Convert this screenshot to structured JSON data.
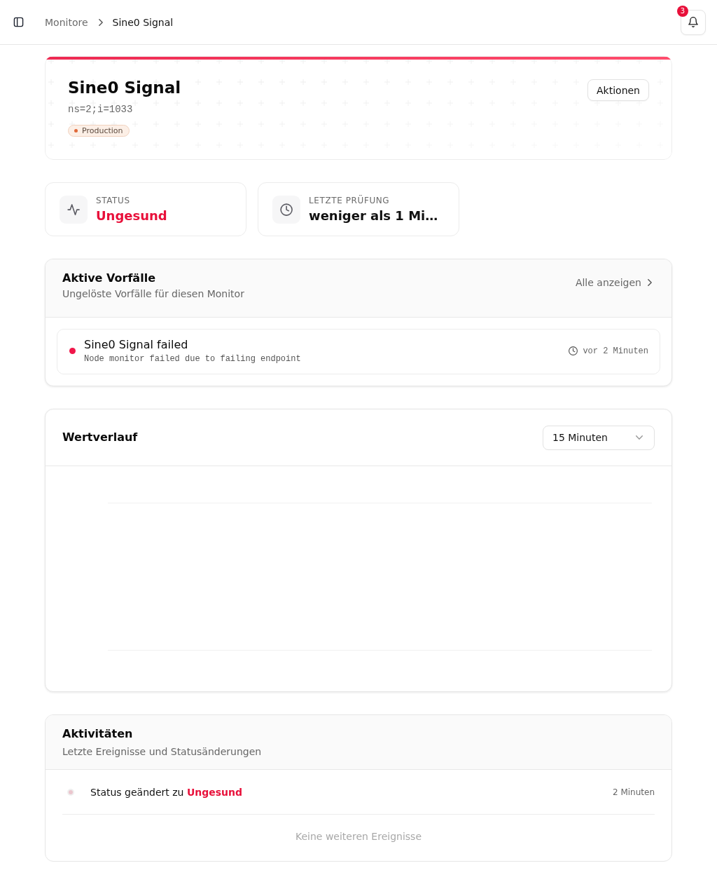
{
  "topbar": {
    "breadcrumbs": [
      {
        "label": "Monitore",
        "current": false
      },
      {
        "label": "Sine0 Signal",
        "current": true
      }
    ],
    "notification_count": "3"
  },
  "monitor": {
    "title": "Sine0 Signal",
    "node_id": "ns=2;i=1033",
    "tag": "Production",
    "actions_button": "Aktionen"
  },
  "stats": [
    {
      "kind": "status",
      "label": "STATUS",
      "value": "Ungesund",
      "color": "#e8103a"
    },
    {
      "kind": "last_check",
      "label": "LETZTE PRÜFUNG",
      "value": "weniger als 1 Mi…",
      "color": "#111111"
    }
  ],
  "incidents": {
    "title": "Aktive Vorfälle",
    "subtitle": "Ungelöste Vorfälle für diesen Monitor",
    "view_all": "Alle anzeigen",
    "items": [
      {
        "title": "Sine0 Signal failed",
        "description": "Node monitor failed due to failing endpoint",
        "time": "vor 2 Minuten"
      }
    ]
  },
  "value_history": {
    "title": "Wertverlauf",
    "time_range": "15 Minuten"
  },
  "activities": {
    "title": "Aktivitäten",
    "subtitle": "Letzte Ereignisse und Statusänderungen",
    "items": [
      {
        "text": "Status geändert zu **Ungesund**",
        "time": "2 Minuten"
      }
    ],
    "empty_text": "Keine weiteren Ereignisse"
  }
}
